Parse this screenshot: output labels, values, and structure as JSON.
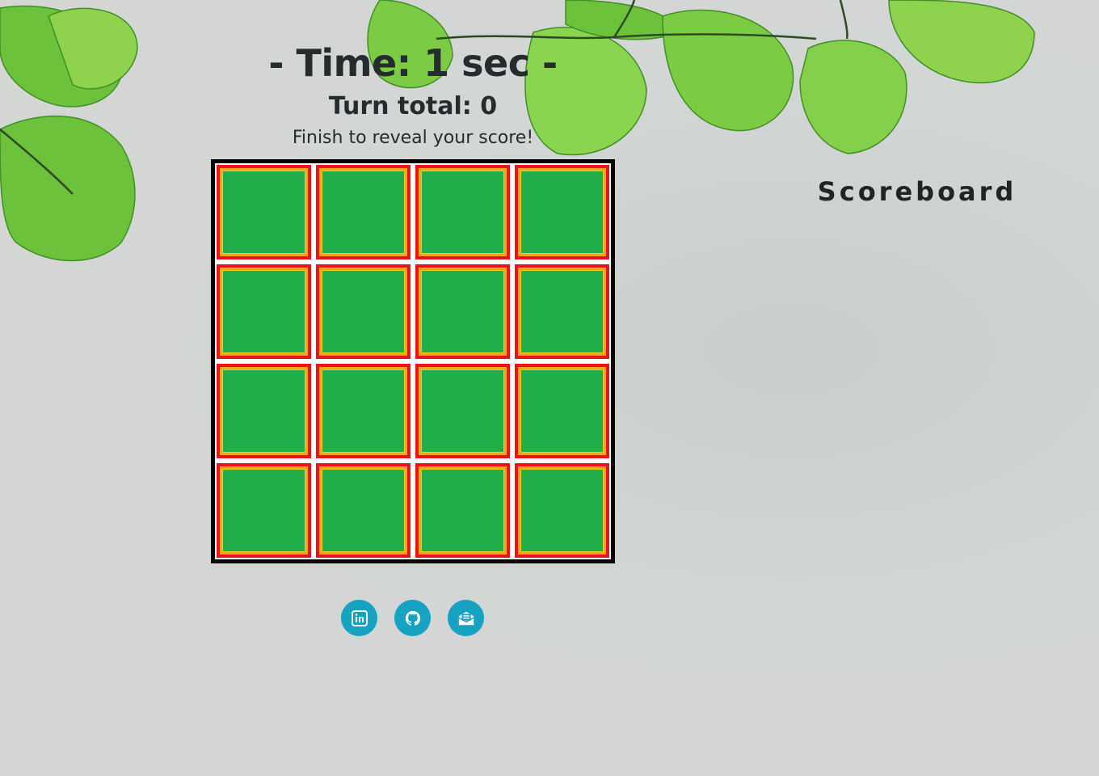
{
  "game": {
    "timer_text": "- Time: 1 sec -",
    "turns_text": "Turn total: 0",
    "finish_text": "Finish to reveal your score!"
  },
  "board": {
    "rows": 4,
    "columns": 4,
    "cards_face_down": 16,
    "card_colors": {
      "border": "#e8141a",
      "inner_border": "#f5a51c",
      "face": "#22ad4b"
    },
    "frame_color": "#000000"
  },
  "scoreboard": {
    "title": "Scoreboard"
  },
  "socials": [
    {
      "name": "linkedin",
      "icon": "linkedin-icon"
    },
    {
      "name": "github",
      "icon": "github-icon"
    },
    {
      "name": "email",
      "icon": "mail-icon"
    }
  ],
  "colors": {
    "accent": "#17a2c2",
    "text": "#262b2d"
  }
}
